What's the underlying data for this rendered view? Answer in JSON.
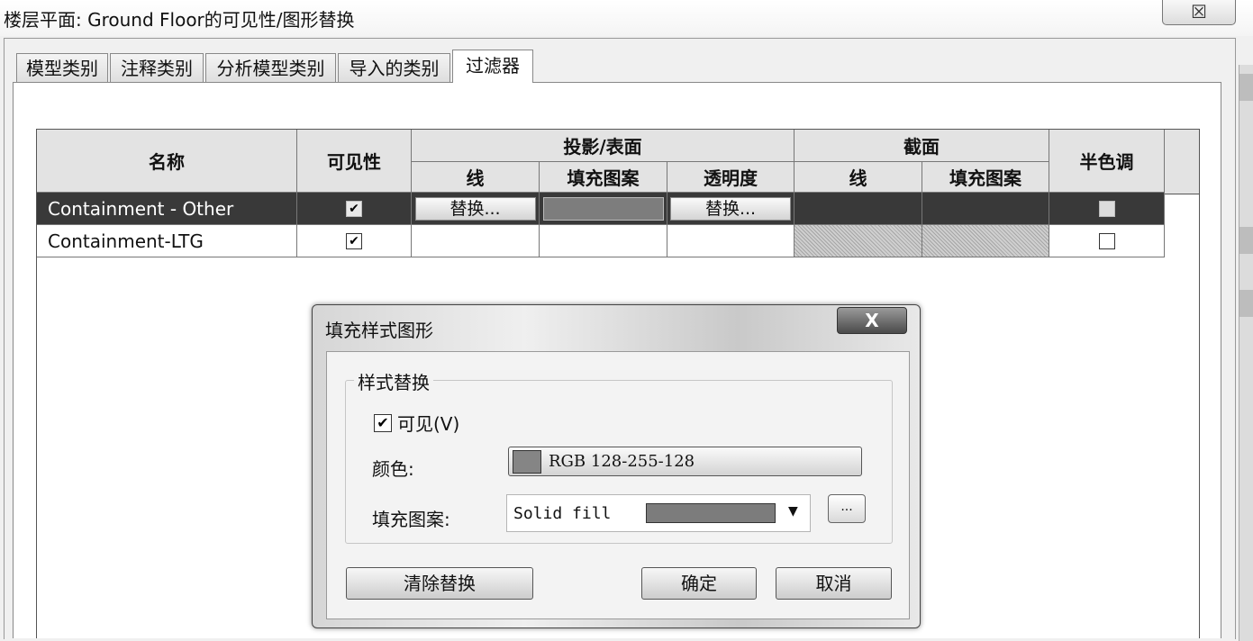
{
  "window": {
    "title": "楼层平面: Ground Floor的可见性/图形替换",
    "close_glyph": "☒"
  },
  "tabs": [
    {
      "label": "模型类别",
      "active": false
    },
    {
      "label": "注释类别",
      "active": false
    },
    {
      "label": "分析模型类别",
      "active": false
    },
    {
      "label": "导入的类别",
      "active": false
    },
    {
      "label": "过滤器",
      "active": true
    }
  ],
  "grid": {
    "headers": {
      "name": "名称",
      "visibility": "可见性",
      "projection_group": "投影/表面",
      "projection_line": "线",
      "projection_fill": "填充图案",
      "projection_transparency": "透明度",
      "cut_group": "截面",
      "cut_line": "线",
      "cut_fill": "填充图案",
      "halftone": "半色调"
    },
    "rows": [
      {
        "name": "Containment - Other",
        "visible": true,
        "line_button": "替换...",
        "transparency_button": "替换...",
        "halftone": false,
        "selected": true
      },
      {
        "name": "Containment-LTG",
        "visible": true,
        "halftone": false,
        "selected": false
      }
    ],
    "check_glyph": "✔"
  },
  "dialog": {
    "title": "填充样式图形",
    "close_glyph": "X",
    "group_label": "样式替换",
    "visible_label": "可见(V)",
    "visible_checked": true,
    "color_label": "颜色:",
    "color_value": "RGB 128-255-128",
    "pattern_label": "填充图案:",
    "pattern_value": "Solid fill",
    "dropdown_glyph": "▼",
    "ellipsis_label": "...",
    "clear_button": "清除替换",
    "ok_button": "确定",
    "cancel_button": "取消"
  }
}
